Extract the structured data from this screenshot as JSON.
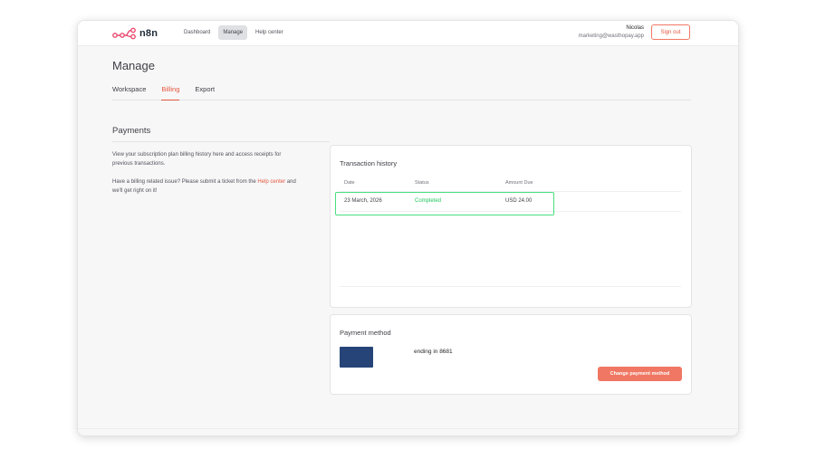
{
  "app": {
    "logo_text": "n8n"
  },
  "nav": {
    "items": [
      {
        "label": "Dashboard"
      },
      {
        "label": "Manage"
      },
      {
        "label": "Help center"
      }
    ]
  },
  "user": {
    "name": "Nicolas",
    "email": "marketing@wasthopay.app",
    "sign_out_label": "Sign out"
  },
  "page": {
    "title": "Manage"
  },
  "tabs": [
    {
      "label": "Workspace"
    },
    {
      "label": "Billing"
    },
    {
      "label": "Export"
    }
  ],
  "payments": {
    "title": "Payments",
    "description": "View your subscription plan billing history here and access receipts for previous transactions.",
    "issue_prefix": "Have a billing related issue? Please submit a ticket from the ",
    "issue_link": "Help center",
    "issue_suffix": " and we'll get right on it!"
  },
  "transaction_history": {
    "title": "Transaction history",
    "columns": [
      "Date",
      "Status",
      "Amount Due"
    ],
    "rows": [
      {
        "date": "23 March, 2026",
        "status": "Completed",
        "amount": "USD 24.00"
      }
    ]
  },
  "payment_method": {
    "title": "Payment method",
    "card_text": "ending in 8681",
    "card_color": "#264478",
    "change_button_label": "Change payment method"
  },
  "colors": {
    "accent": "#e4573d",
    "button": "#f07763",
    "success": "#22c55e",
    "highlight": "#4ade80"
  }
}
